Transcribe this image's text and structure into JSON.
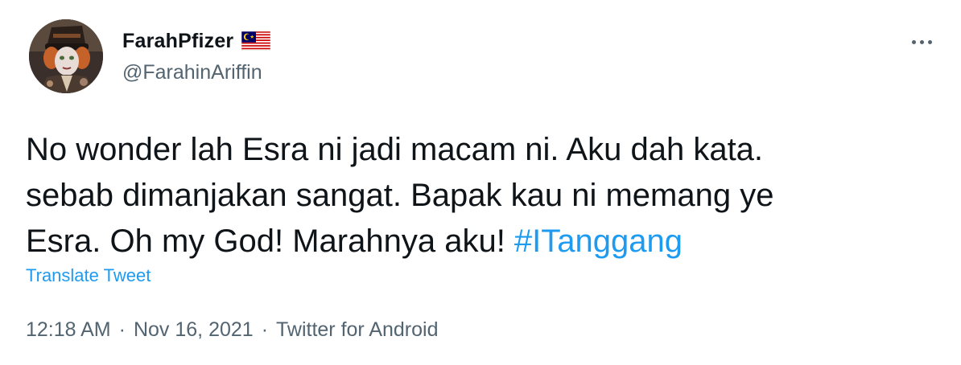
{
  "user": {
    "display_name": "FarahPfizer",
    "flag_icon": "malaysia-flag-icon",
    "handle": "@FarahinAriffin",
    "avatar_icon": "profile-avatar"
  },
  "more_icon": "more-horizontal-icon",
  "tweet": {
    "line1": "No wonder lah Esra ni jadi macam ni. Aku dah kata.",
    "line2": "sebab dimanjakan sangat. Bapak kau ni memang ye",
    "line3_text": "Esra. Oh my God! Marahnya aku! ",
    "hashtag": "#ITanggang"
  },
  "translate_label": "Translate Tweet",
  "meta": {
    "time": "12:18 AM",
    "separator": "·",
    "date": "Nov 16, 2021",
    "source": "Twitter for Android"
  },
  "colors": {
    "link": "#1d9bf0",
    "secondary_text": "#536471",
    "primary_text": "#0f1419",
    "background": "#ffffff"
  }
}
